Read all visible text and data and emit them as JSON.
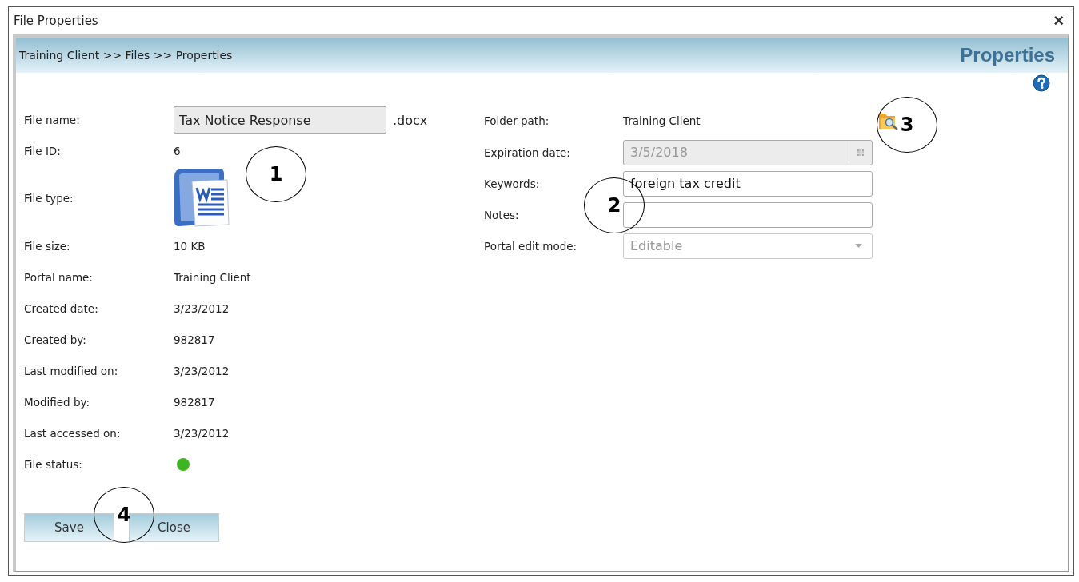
{
  "window": {
    "title": "File Properties",
    "close": "×"
  },
  "breadcrumb": "Training Client >> Files >> Properties",
  "heading": "Properties",
  "left_fields": [
    {
      "kind": "input",
      "label": "File name:",
      "value": "Tax Notice Response",
      "suffix": ".docx"
    },
    {
      "kind": "text",
      "label": "File ID:",
      "value": "6"
    },
    {
      "kind": "filetype",
      "label": "File type:"
    },
    {
      "kind": "text",
      "label": "File size:",
      "value": "10 KB"
    },
    {
      "kind": "text",
      "label": "Portal name:",
      "value": "Training Client"
    },
    {
      "kind": "text",
      "label": "Created date:",
      "value": "3/23/2012"
    },
    {
      "kind": "text",
      "label": "Created by:",
      "value": "982817"
    },
    {
      "kind": "text",
      "label": "Last modified on:",
      "value": "3/23/2012"
    },
    {
      "kind": "text",
      "label": "Modified by:",
      "value": "982817"
    },
    {
      "kind": "text",
      "label": "Last accessed on:",
      "value": "3/23/2012"
    },
    {
      "kind": "status",
      "label": "File status:",
      "color": "#3cb521"
    }
  ],
  "right_fields": [
    {
      "kind": "text",
      "label": "Folder path:",
      "value": "Training Client"
    },
    {
      "kind": "date",
      "label": "Expiration date:",
      "value": "3/5/2018",
      "disabled": true
    },
    {
      "kind": "input",
      "label": "Keywords:",
      "value": "foreign tax credit",
      "disabled": false
    },
    {
      "kind": "input",
      "label": "Notes:",
      "disabled": false
    },
    {
      "kind": "select",
      "label": "Portal edit mode:",
      "value": "Editable",
      "disabled": true
    }
  ],
  "buttons": [
    "Save",
    "Close"
  ],
  "callouts": [
    "1",
    "2",
    "3",
    "4"
  ]
}
